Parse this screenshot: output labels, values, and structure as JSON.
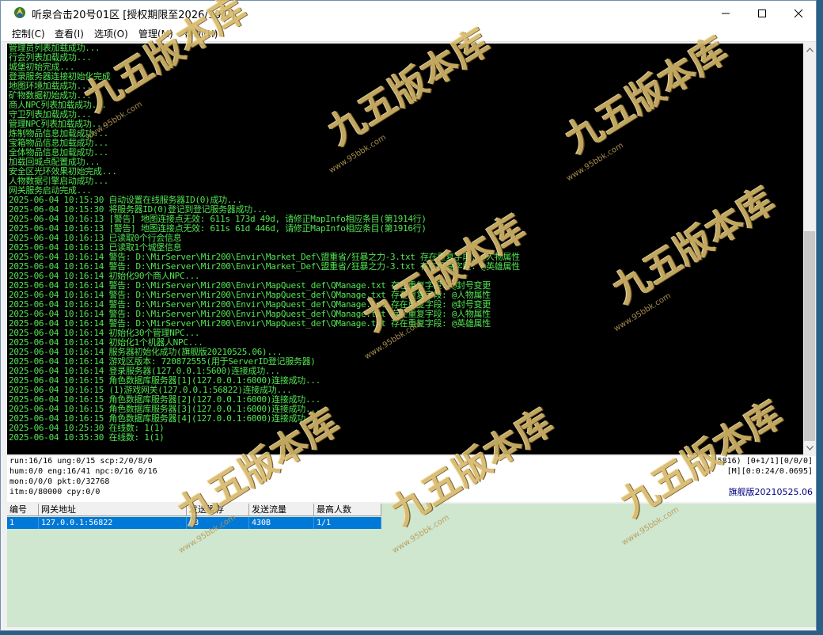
{
  "window": {
    "title": "听泉合击20号01区 [授权期限至2026/10/7]",
    "minimize_glyph": "—",
    "maximize_glyph": "☐",
    "close_glyph": "✕"
  },
  "menu": {
    "items": [
      "控制(C)",
      "查看(I)",
      "选项(O)",
      "管理(M)",
      "帮助(H)"
    ]
  },
  "console": {
    "text_color": "#52e552",
    "lines": [
      "管理员列表加载成功...",
      "行会列表加载成功...",
      "城堡初始完成...",
      "登录服务器连接初始化完成",
      "地图环境加载成功...",
      "矿物数据初始成功...",
      "商人NPC列表加载成功...",
      "守卫列表加载成功...",
      "管理NPC列表加载成功...",
      "炼制物品信息加载成功...",
      "宝箱物品信息加载成功...",
      "全体物品信息加载成功...",
      "加载回城点配置成功...",
      "安全区光环效果初始完成...",
      "人物数据引擎启动成功...",
      "网关服务启动完成...",
      "2025-06-04 10:15:30 自动设置在线服务器ID(0)成功...",
      "2025-06-04 10:15:30 将服务器ID(0)登记到登记服务器成功...",
      "2025-06-04 10:16:13 [警告] 地图连接点无效: 611s 173d 49d, 请修正MapInfo相应条目(第1914行)",
      "2025-06-04 10:16:13 [警告] 地图连接点无效: 611s 61d 446d, 请修正MapInfo相应条目(第1916行)",
      "2025-06-04 10:16:13 已读取0个行会信息",
      "2025-06-04 10:16:13 已读取1个城堡信息",
      "2025-06-04 10:16:14 警告: D:\\MirServer\\Mir200\\Envir\\Market_Def\\盟重省/狂暴之力-3.txt 存在重复字段: @人物属性",
      "2025-06-04 10:16:14 警告: D:\\MirServer\\Mir200\\Envir\\Market_Def\\盟重省/狂暴之力-3.txt 存在重复字段: @英雄属性",
      "2025-06-04 10:16:14 初始化90个商人NPC...",
      "2025-06-04 10:16:14 警告: D:\\MirServer\\Mir200\\Envir\\MapQuest_def\\QManage.txt 存在重复字段: @封号变更",
      "2025-06-04 10:16:14 警告: D:\\MirServer\\Mir200\\Envir\\MapQuest_def\\QManage.txt 存在重复字段: @人物属性",
      "2025-06-04 10:16:14 警告: D:\\MirServer\\Mir200\\Envir\\MapQuest_def\\QManage.txt 存在重复字段: @封号变更",
      "2025-06-04 10:16:14 警告: D:\\MirServer\\Mir200\\Envir\\MapQuest_def\\QManage.txt 存在重复字段: @人物属性",
      "2025-06-04 10:16:14 警告: D:\\MirServer\\Mir200\\Envir\\MapQuest_def\\QManage.txt 存在重复字段: @英雄属性",
      "2025-06-04 10:16:14 初始化30个管理NPC...",
      "2025-06-04 10:16:14 初始化1个机器人NPC...",
      "2025-06-04 10:16:14 服务器初始化成功(旗舰版20210525.06)...",
      "2025-06-04 10:16:14 游戏区版本: 720872555(用于ServerID登记服务器)",
      "2025-06-04 10:16:14 登录服务器(127.0.0.1:5600)连接成功...",
      "2025-06-04 10:16:15 角色数据库服务器[1](127.0.0.1:6000)连接成功...",
      "2025-06-04 10:16:15 (1)游戏网关(127.0.0.1:56822)连接成功...",
      "2025-06-04 10:16:15 角色数据库服务器[2](127.0.0.1:6000)连接成功...",
      "2025-06-04 10:16:15 角色数据库服务器[3](127.0.0.1:6000)连接成功...",
      "2025-06-04 10:16:15 角色数据库服务器[4](127.0.0.1:6000)连接成功...",
      "2025-06-04 10:25:30 在线数: 1(1)",
      "2025-06-04 10:35:30 在线数: 1(1)"
    ]
  },
  "status": {
    "left": [
      "run:16/16 ung:0/15 scp:2/0/8/0",
      "hum:0/0 eng:16/41 npc:0/16 0/16",
      "mon:0/0/0 pkt:0/32768",
      "itm:0/80000 cpy:0/0"
    ],
    "right": [
      "(5816) [0+1/1][0/0/0]",
      "[M][0:0:24/0.0695]"
    ],
    "version": "旗舰版20210525.06"
  },
  "gate_table": {
    "headers": [
      "编号",
      "网关地址",
      "发送缓存",
      "发送流量",
      "最高人数"
    ],
    "rows": [
      [
        "1",
        "127.0.0.1:56822",
        "0B",
        "430B",
        "1/1"
      ]
    ]
  },
  "watermark": {
    "text": "九五版本库",
    "url": "www.95bbk.com"
  }
}
